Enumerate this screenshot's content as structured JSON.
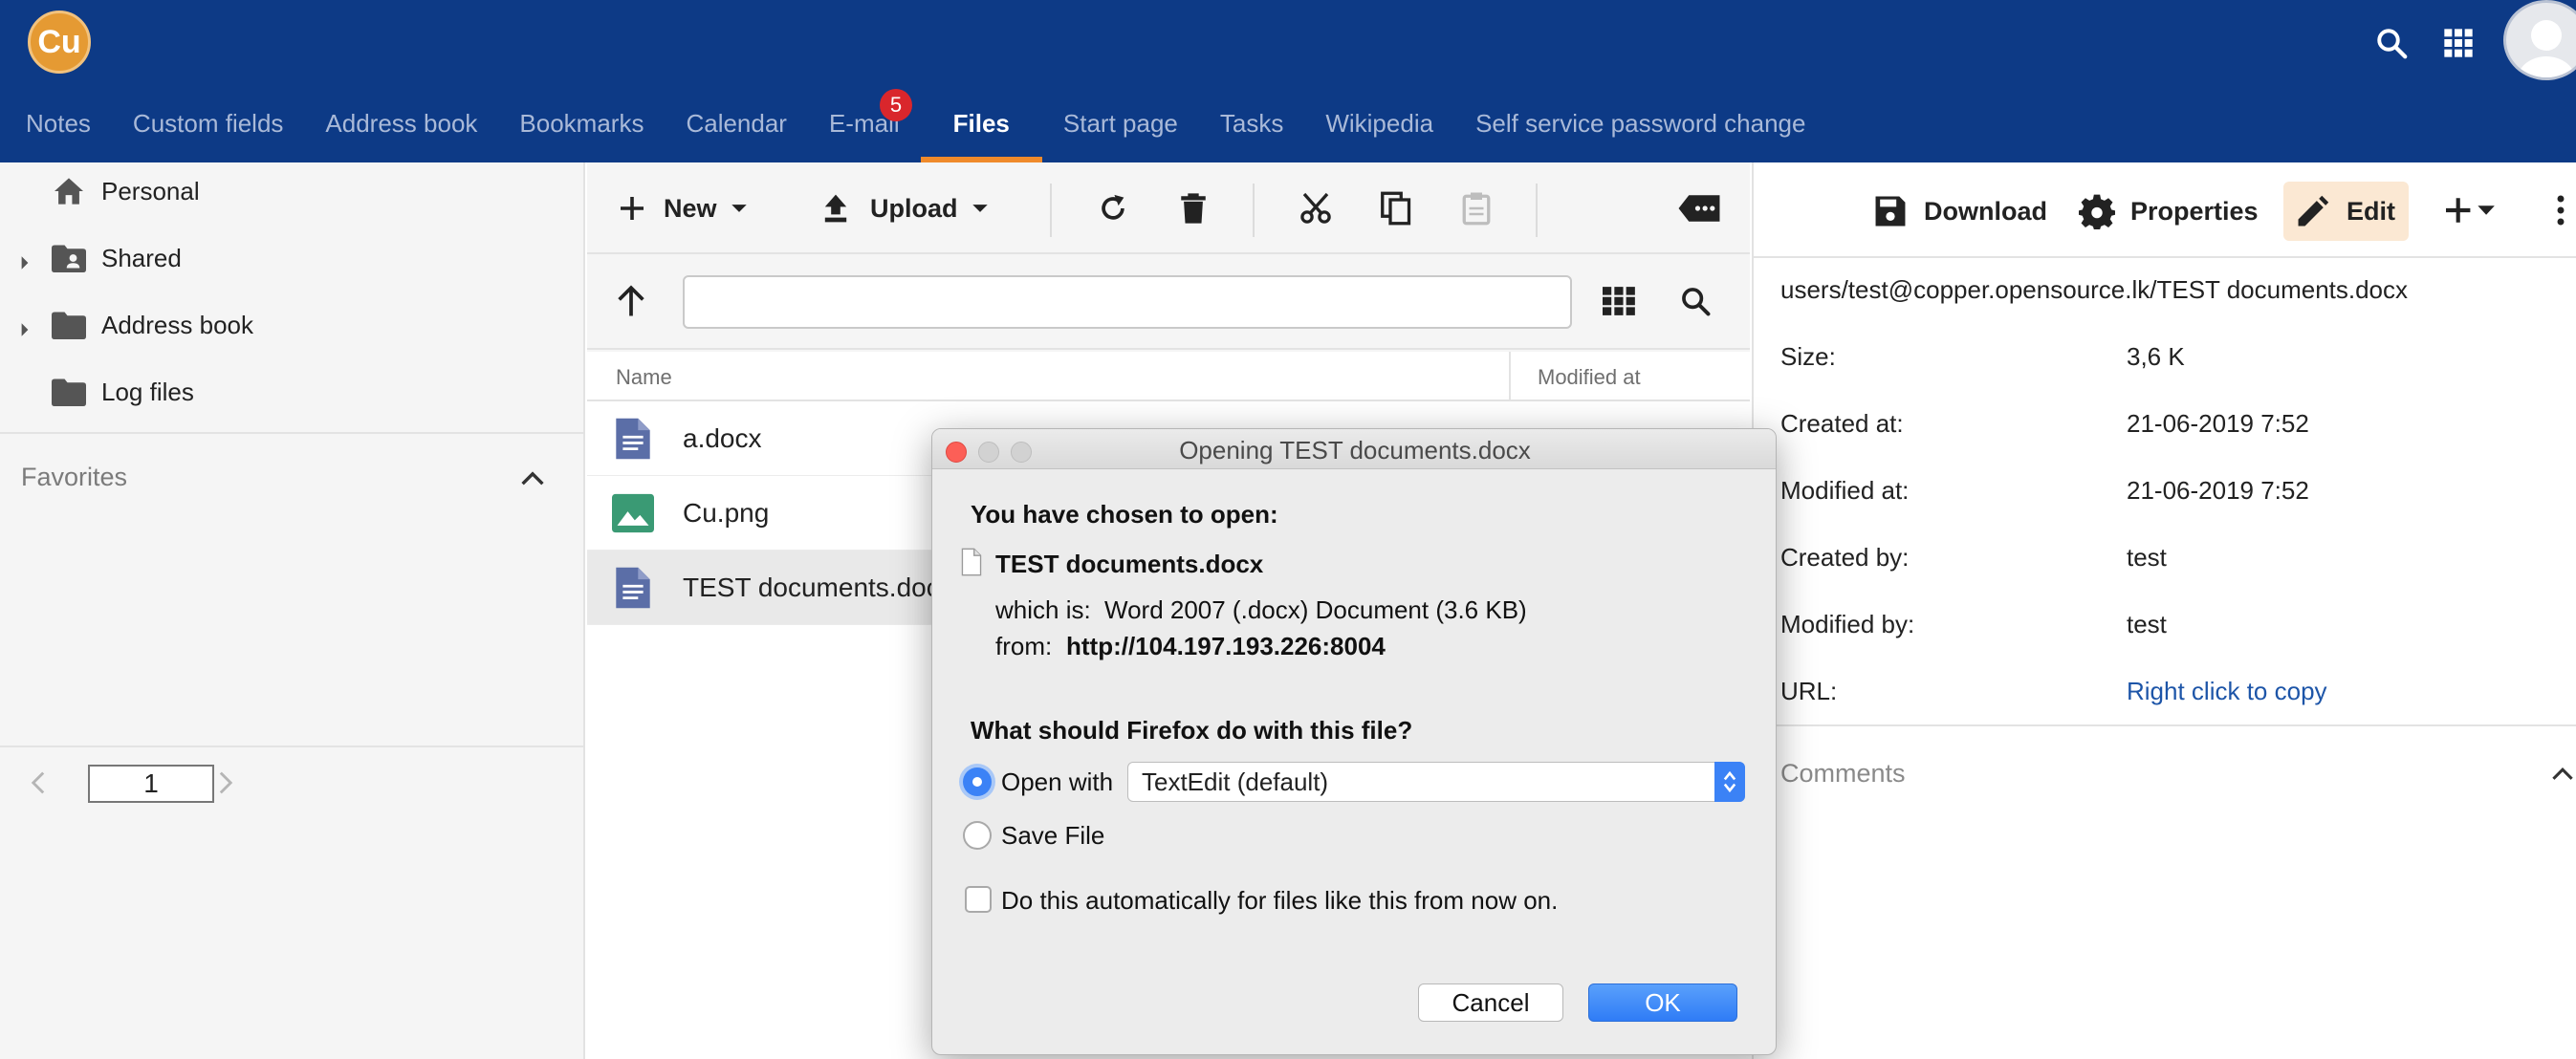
{
  "header": {
    "logo_text": "Cu",
    "nav": [
      {
        "label": "Notes"
      },
      {
        "label": "Custom fields"
      },
      {
        "label": "Address book"
      },
      {
        "label": "Bookmarks"
      },
      {
        "label": "Calendar"
      },
      {
        "label": "E-mail",
        "badge": "5"
      },
      {
        "label": "Files",
        "active": true
      },
      {
        "label": "Start page"
      },
      {
        "label": "Tasks"
      },
      {
        "label": "Wikipedia"
      },
      {
        "label": "Self service password change"
      }
    ],
    "icons": [
      "search-icon",
      "apps-grid-icon",
      "user-avatar"
    ]
  },
  "sidebar": {
    "tree": [
      {
        "label": "Personal",
        "icon": "home-icon"
      },
      {
        "label": "Shared",
        "icon": "shared-folder-icon"
      },
      {
        "label": "Address book",
        "icon": "folder-icon"
      },
      {
        "label": "Log files",
        "icon": "folder-icon"
      }
    ],
    "favorites_label": "Favorites",
    "page_number": "1"
  },
  "toolbar": {
    "new_label": "New",
    "upload_label": "Upload"
  },
  "file_list": {
    "columns": {
      "name": "Name",
      "modified": "Modified at"
    },
    "rows": [
      {
        "name": "a.docx",
        "icon": "document-icon"
      },
      {
        "name": "Cu.png",
        "icon": "image-icon"
      },
      {
        "name": "TEST documents.docx",
        "icon": "document-icon",
        "selected": true
      }
    ]
  },
  "details": {
    "download_label": "Download",
    "properties_label": "Properties",
    "edit_label": "Edit",
    "path": "users/test@copper.opensource.lk/TEST documents.docx",
    "props": [
      {
        "label": "Size:",
        "value": "3,6 K"
      },
      {
        "label": "Created at:",
        "value": "21-06-2019 7:52"
      },
      {
        "label": "Modified at:",
        "value": "21-06-2019 7:52"
      },
      {
        "label": "Created by:",
        "value": "test"
      },
      {
        "label": "Modified by:",
        "value": "test"
      },
      {
        "label": "URL:",
        "value": "Right click to copy",
        "link": true
      }
    ],
    "comments_label": "Comments"
  },
  "dialog": {
    "title": "Opening TEST documents.docx",
    "chosen": "You have chosen to open:",
    "filename": "TEST documents.docx",
    "which_is_label": "which is:",
    "which_is_value": "Word 2007 (.docx) Document (3.6 KB)",
    "from_label": "from:",
    "from_value": "http://104.197.193.226:8004",
    "question": "What should Firefox do with this file?",
    "open_with_label": "Open with",
    "open_with_app": "TextEdit (default)",
    "save_file_label": "Save File",
    "auto_label": "Do this automatically for files like this from now on.",
    "cancel_label": "Cancel",
    "ok_label": "OK"
  }
}
